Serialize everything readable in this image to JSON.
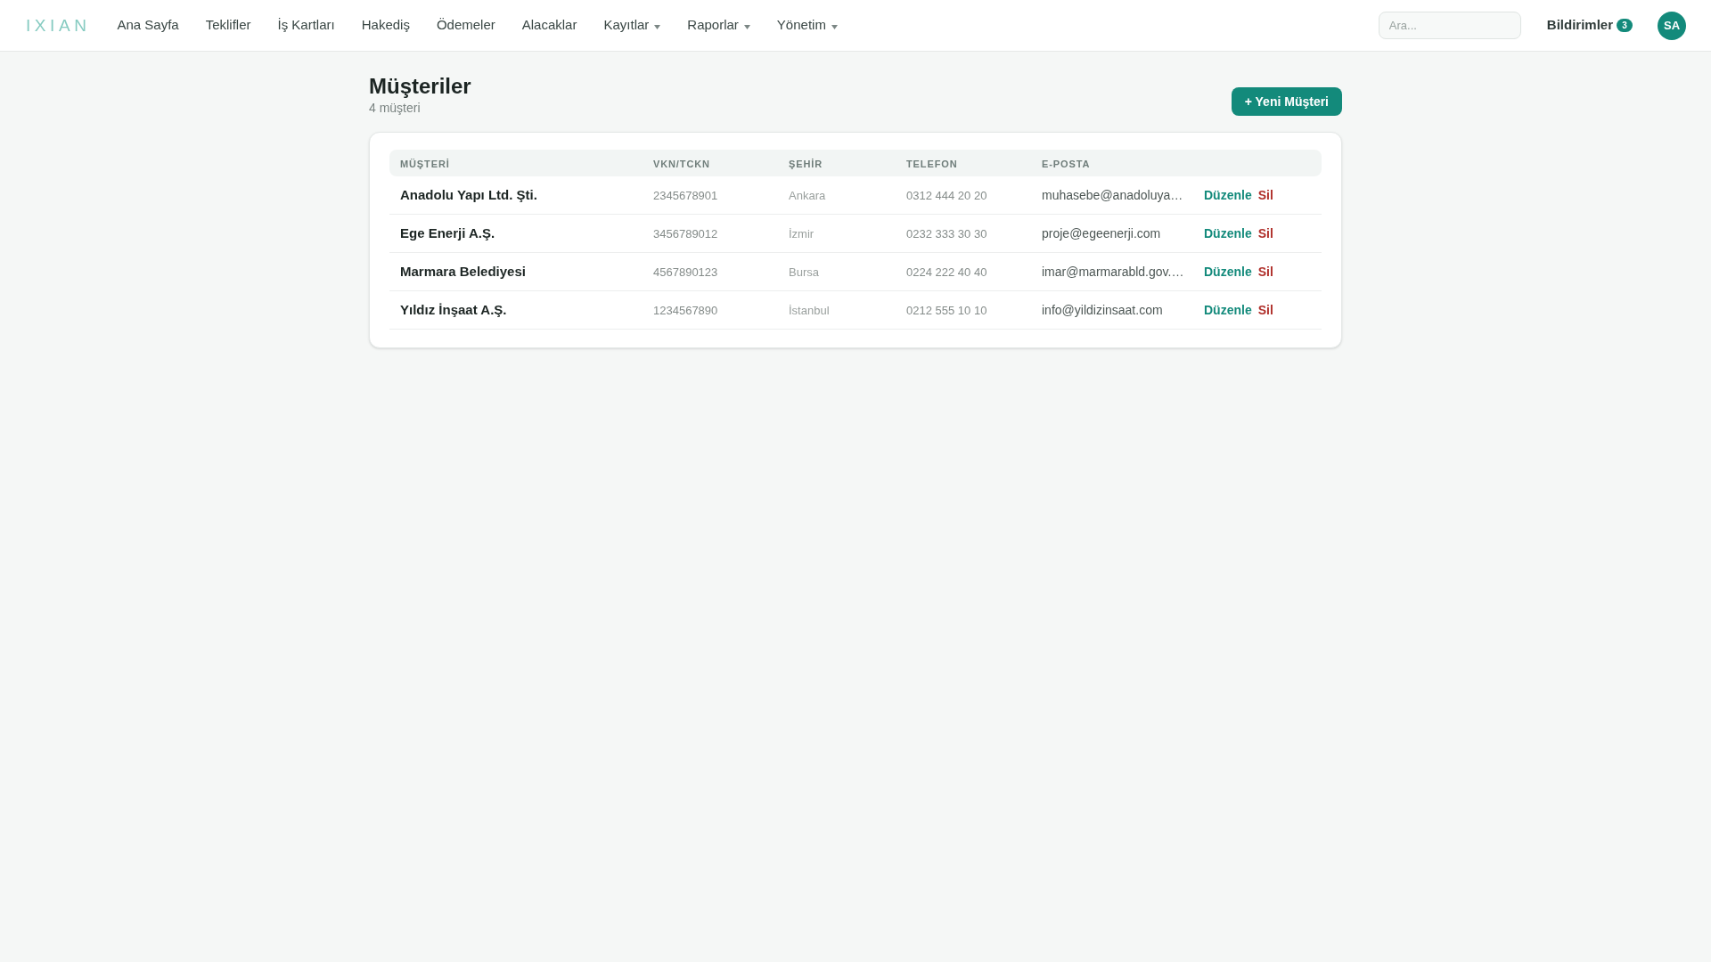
{
  "brand": {
    "logo": "IXIAN"
  },
  "nav": {
    "items": [
      {
        "label": "Ana Sayfa",
        "kind": "link"
      },
      {
        "label": "Teklifler",
        "kind": "link"
      },
      {
        "label": "İş Kartları",
        "kind": "link"
      },
      {
        "label": "Hakediş",
        "kind": "link"
      },
      {
        "label": "Ödemeler",
        "kind": "link"
      },
      {
        "label": "Alacaklar",
        "kind": "link"
      },
      {
        "label": "Kayıtlar",
        "kind": "dropdown"
      },
      {
        "label": "Raporlar",
        "kind": "dropdown"
      },
      {
        "label": "Yönetim",
        "kind": "dropdown"
      }
    ]
  },
  "search": {
    "placeholder": "Ara..."
  },
  "notifications": {
    "label": "Bildirimler",
    "count": "3"
  },
  "user": {
    "initials": "SA"
  },
  "page": {
    "title": "Müşteriler",
    "subtitle": "4 müşteri",
    "new_button": "+ Yeni Müşteri"
  },
  "table": {
    "columns": [
      "MÜŞTERİ",
      "VKN/TCKN",
      "ŞEHİR",
      "TELEFON",
      "E-POSTA"
    ],
    "rows": [
      {
        "name": "Anadolu Yapı Ltd. Şti.",
        "tax_id": "2345678901",
        "city": "Ankara",
        "phone": "0312 444 20 20",
        "email": "muhasebe@anadoluya…",
        "edit": "Düzenle",
        "delete": "Sil"
      },
      {
        "name": "Ege Enerji A.Ş.",
        "tax_id": "3456789012",
        "city": "İzmir",
        "phone": "0232 333 30 30",
        "email": "proje@egeenerji.com",
        "edit": "Düzenle",
        "delete": "Sil"
      },
      {
        "name": "Marmara Belediyesi",
        "tax_id": "4567890123",
        "city": "Bursa",
        "phone": "0224 222 40 40",
        "email": "imar@marmarabld.gov.…",
        "edit": "Düzenle",
        "delete": "Sil"
      },
      {
        "name": "Yıldız İnşaat A.Ş.",
        "tax_id": "1234567890",
        "city": "İstanbul",
        "phone": "0212 555 10 10",
        "email": "info@yildizinsaat.com",
        "edit": "Düzenle",
        "delete": "Sil"
      }
    ]
  }
}
